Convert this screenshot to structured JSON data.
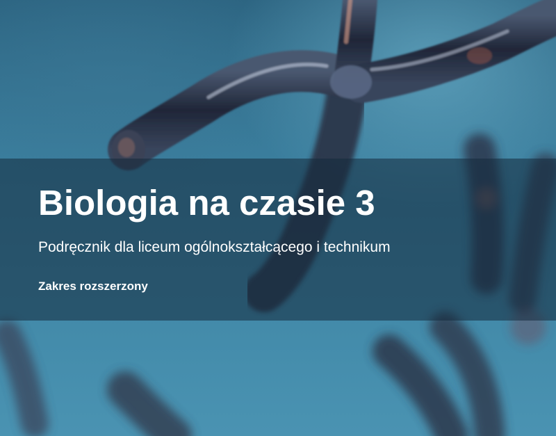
{
  "cover": {
    "title": "Biologia na czasie 3",
    "subtitle": "Podręcznik dla liceum ogólnokształcącego i technikum",
    "range": "Zakres rozszerzony"
  },
  "image": {
    "subject": "chromosome-illustration",
    "background_color": "#3a7d9c",
    "band_color": "#142a3c",
    "text_color": "#ffffff"
  }
}
